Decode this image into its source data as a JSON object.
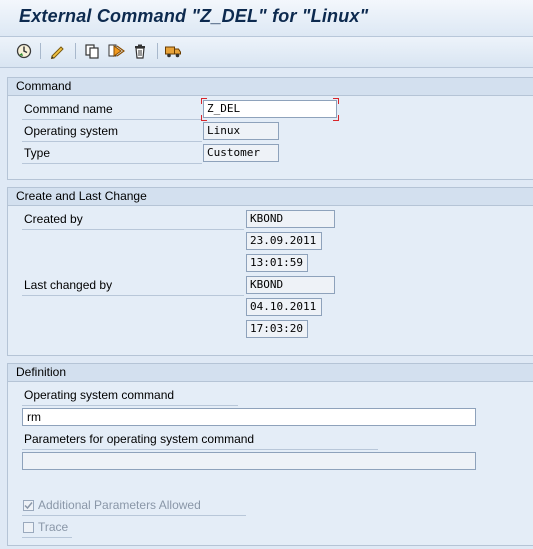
{
  "window": {
    "title": "External Command \"Z_DEL\" for \"Linux\""
  },
  "toolbar": {
    "buttons": [
      {
        "name": "execute-icon"
      },
      {
        "name": "edit-icon"
      },
      {
        "name": "copy-icon"
      },
      {
        "name": "where-used-icon"
      },
      {
        "name": "delete-icon"
      },
      {
        "name": "transport-icon"
      }
    ]
  },
  "command": {
    "header": "Command",
    "name_label": "Command name",
    "name_value": "Z_DEL",
    "os_label": "Operating system",
    "os_value": "Linux",
    "type_label": "Type",
    "type_value": "Customer"
  },
  "change": {
    "header": "Create and Last Change",
    "created_label": "Created by",
    "created_by": "KBOND",
    "created_date": "23.09.2011",
    "created_time": "13:01:59",
    "changed_label": "Last changed by",
    "changed_by": "KBOND",
    "changed_date": "04.10.2011",
    "changed_time": "17:03:20"
  },
  "definition": {
    "header": "Definition",
    "os_command_label": "Operating system command",
    "os_command_value": "rm",
    "params_label": "Parameters for operating system command",
    "params_value": "",
    "additional_params_label": "Additional Parameters Allowed",
    "additional_params_checked": true,
    "trace_label": "Trace",
    "trace_checked": false
  }
}
